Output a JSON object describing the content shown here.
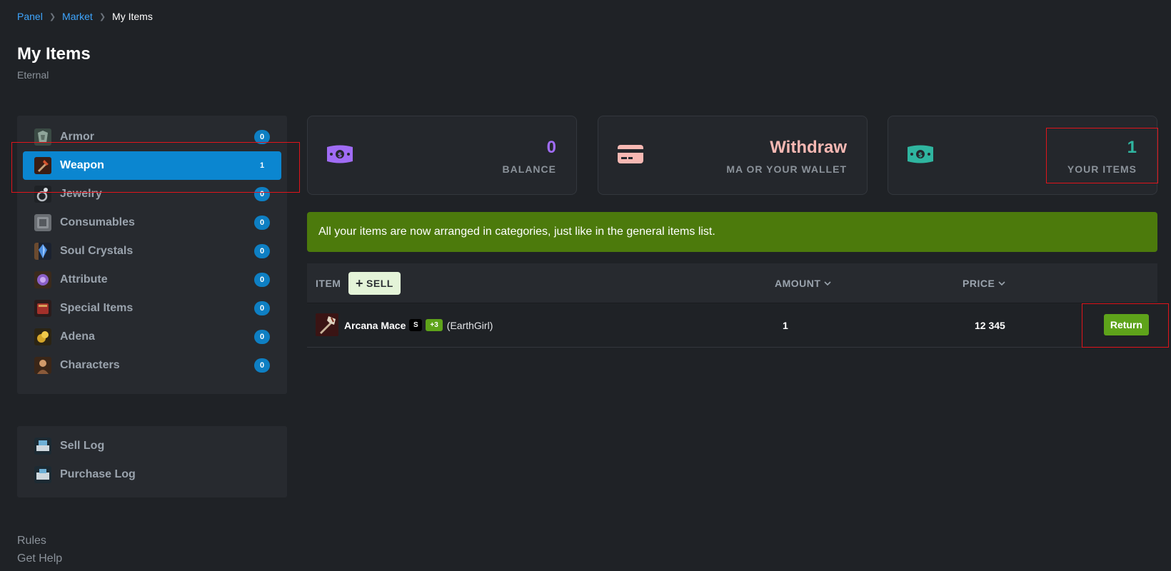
{
  "breadcrumb": {
    "items": [
      "Panel",
      "Market"
    ],
    "current": "My Items"
  },
  "page": {
    "title": "My Items",
    "subtitle": "Eternal"
  },
  "sidebar": {
    "categories": [
      {
        "label": "Armor",
        "count": "0",
        "icon": "armor-icon"
      },
      {
        "label": "Weapon",
        "count": "1",
        "icon": "weapon-icon"
      },
      {
        "label": "Jewelry",
        "count": "0",
        "icon": "jewelry-icon"
      },
      {
        "label": "Consumables",
        "count": "0",
        "icon": "consumables-icon"
      },
      {
        "label": "Soul Crystals",
        "count": "0",
        "icon": "soul-crystal-icon"
      },
      {
        "label": "Attribute",
        "count": "0",
        "icon": "attribute-icon"
      },
      {
        "label": "Special Items",
        "count": "0",
        "icon": "special-items-icon"
      },
      {
        "label": "Adena",
        "count": "0",
        "icon": "adena-icon"
      },
      {
        "label": "Characters",
        "count": "0",
        "icon": "characters-icon"
      }
    ],
    "active_index": 1,
    "logs": [
      {
        "label": "Sell Log",
        "icon": "sell-log-icon"
      },
      {
        "label": "Purchase Log",
        "icon": "purchase-log-icon"
      }
    ]
  },
  "footer": {
    "rules": "Rules",
    "help": "Get Help"
  },
  "stats": {
    "balance": {
      "value": "0",
      "label": "BALANCE",
      "color": "#a06cf5",
      "icon": "money-icon"
    },
    "withdraw": {
      "value": "Withdraw",
      "label": "MA OR YOUR WALLET",
      "color": "#f7b8b3",
      "icon": "credit-card-icon"
    },
    "your_items": {
      "value": "1",
      "label": "YOUR ITEMS",
      "color": "#2fb5a0",
      "icon": "money-icon"
    }
  },
  "notice": "All your items are now arranged in categories, just like in the general items list.",
  "table": {
    "col_item": "ITEM",
    "sell_label": "SELL",
    "col_amount": "AMOUNT",
    "col_price": "PRICE",
    "rows": [
      {
        "name": "Arcana Mace",
        "grade": "S",
        "enchant": "+3",
        "owner": "(EarthGirl)",
        "amount": "1",
        "price": "12 345",
        "action": "Return"
      }
    ]
  },
  "colors": {
    "accent": "#0b86d0",
    "success": "#5ea31a",
    "notice_bg": "#4c7a0c",
    "highlight": "#e0141b"
  }
}
